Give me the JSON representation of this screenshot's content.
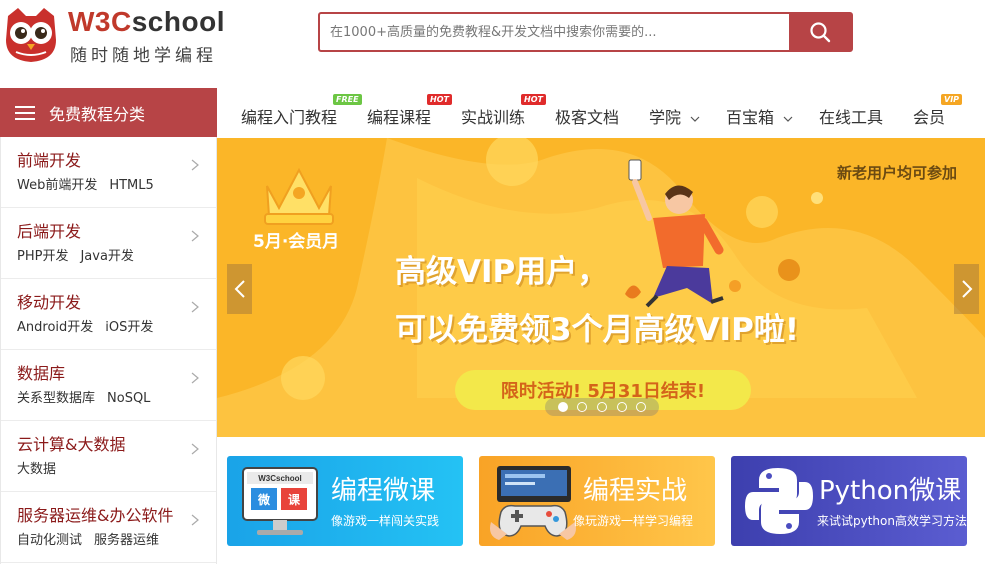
{
  "header": {
    "logo_title_prefix": "W3C",
    "logo_title_suffix": "school",
    "logo_slogan": "随时随地学编程",
    "search_placeholder": "在1000+高质量的免费教程&开发文档中搜索你需要的..."
  },
  "category_header": {
    "label": "免费教程分类"
  },
  "sidebar": {
    "items": [
      {
        "title": "前端开发",
        "subs": [
          "Web前端开发",
          "HTML5"
        ]
      },
      {
        "title": "后端开发",
        "subs": [
          "PHP开发",
          "Java开发"
        ]
      },
      {
        "title": "移动开发",
        "subs": [
          "Android开发",
          "iOS开发"
        ]
      },
      {
        "title": "数据库",
        "subs": [
          "关系型数据库",
          "NoSQL"
        ]
      },
      {
        "title": "云计算&大数据",
        "subs": [
          "大数据"
        ]
      },
      {
        "title": "服务器运维&办公软件",
        "subs": [
          "自动化测试",
          "服务器运维"
        ]
      }
    ]
  },
  "nav": {
    "items": [
      {
        "label": "编程入门教程",
        "badge": "FREE"
      },
      {
        "label": "编程课程",
        "badge": "HOT"
      },
      {
        "label": "实战训练",
        "badge": "HOT"
      },
      {
        "label": "极客文档"
      },
      {
        "label": "学院"
      },
      {
        "label": "百宝箱"
      },
      {
        "label": "在线工具"
      },
      {
        "label": "会员",
        "badge": "VIP"
      }
    ]
  },
  "banner": {
    "top_right": "新老用户均可参加",
    "crown_label": "5月·会员月",
    "headline_1": "高级VIP用户，",
    "headline_2": "可以免费领3个月高级VIP啦!",
    "promo": "限时活动!  5月31日结束!",
    "slide_count": 5,
    "active_slide": 1
  },
  "cards": [
    {
      "title": "编程微课",
      "sub": "像游戏一样闯关实践",
      "thumb_brand": "W3Cschool",
      "thumb_words": [
        "微",
        "课"
      ]
    },
    {
      "title": "编程实战",
      "sub": "像玩游戏一样学习编程"
    },
    {
      "title": "Python微课",
      "sub": "来试试python高效学习方法"
    }
  ],
  "colors": {
    "brand_red": "#b74446",
    "banner_yellow": "#fbb628",
    "card_blue": "#1aa3e8",
    "card_orange": "#f9a326",
    "card_purple": "#3d3fae"
  }
}
